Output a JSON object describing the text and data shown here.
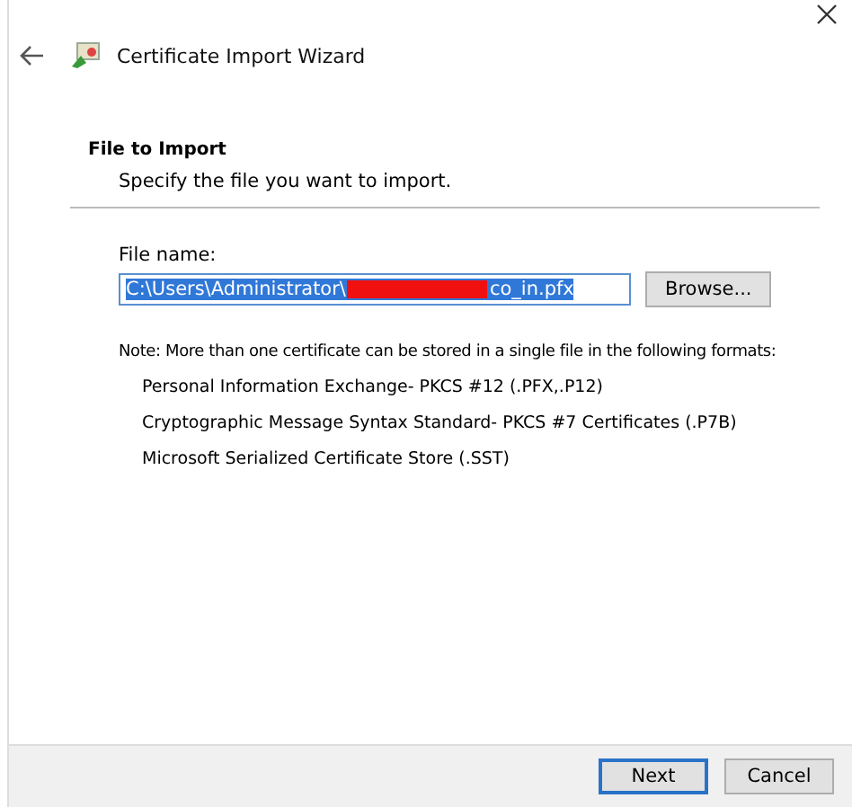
{
  "window": {
    "title": "Certificate Import Wizard"
  },
  "header": {
    "heading": "File to Import",
    "subheading": "Specify the file you want to import."
  },
  "file_field": {
    "label": "File name:",
    "value_start": "C:\\Users\\Administrator\\",
    "redacted": true,
    "value_end": "co_in.pfx",
    "text_selected": true
  },
  "browse_button": "Browse...",
  "note": "Note:  More than one certificate can be stored in a single file in the following formats:",
  "formats": [
    "Personal Information Exchange- PKCS #12 (.PFX,.P12)",
    "Cryptographic Message Syntax Standard- PKCS #7 Certificates (.P7B)",
    "Microsoft Serialized Certificate Store (.SST)"
  ],
  "buttons": [
    {
      "label": "Next",
      "default": true
    },
    {
      "label": "Cancel",
      "default": false
    }
  ]
}
